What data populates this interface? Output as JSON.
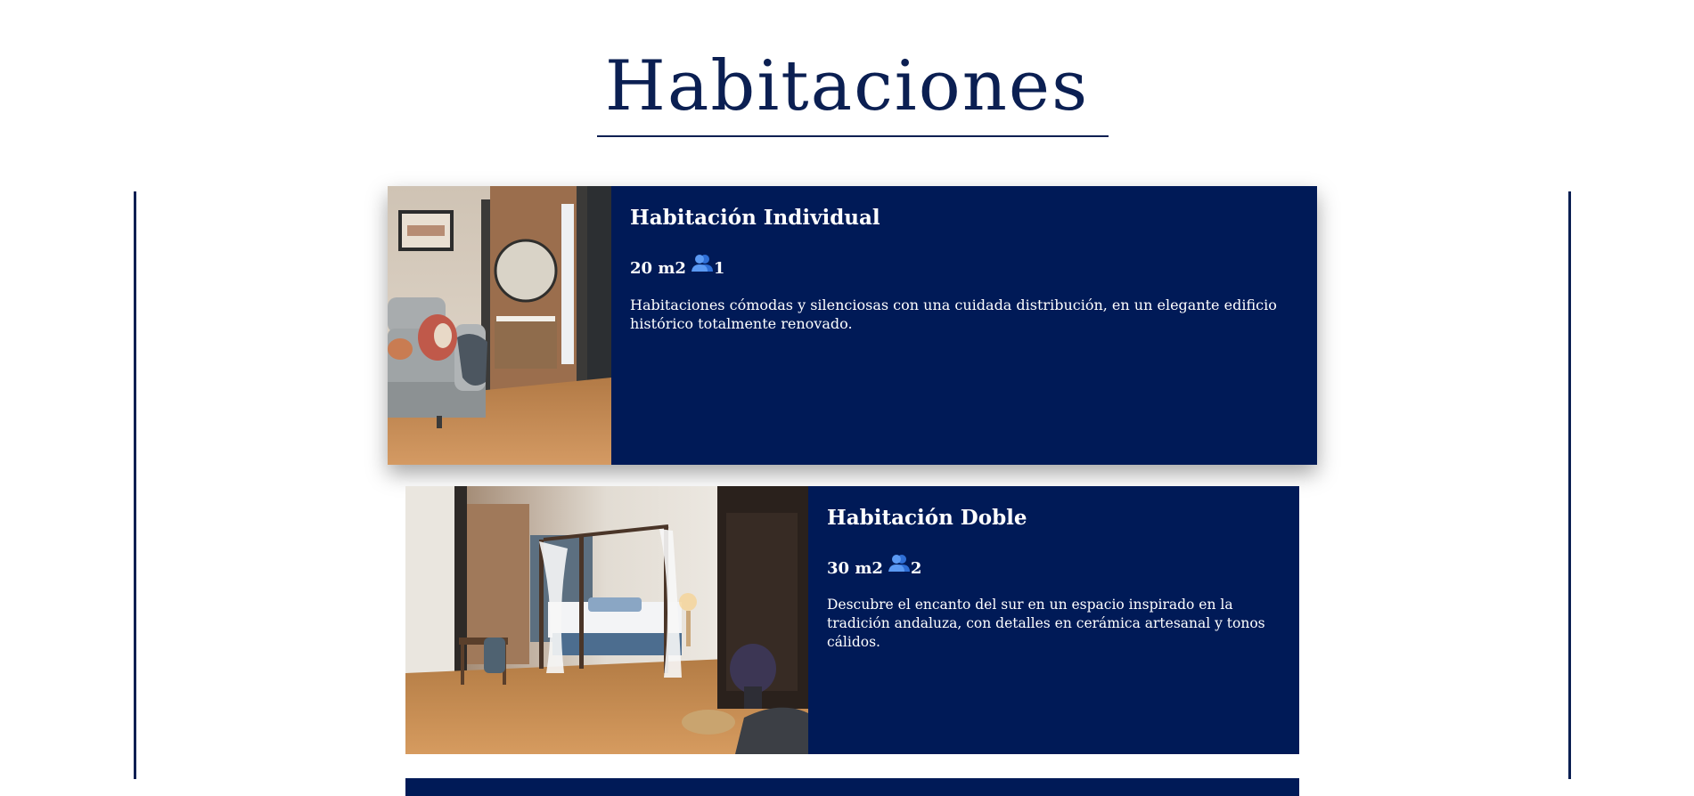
{
  "page": {
    "title": "Habitaciones"
  },
  "rooms": [
    {
      "name": "Habitación Individual",
      "size": "20 m2",
      "guests": "1",
      "description": "Habitaciones cómodas y silenciosas con una cuidada distribución, en un elegante edificio histórico totalmente renovado.",
      "image": "bedroom-with-armchair-and-bathroom-photo",
      "icon": "people-icon"
    },
    {
      "name": "Habitación Doble",
      "size": "30 m2",
      "guests": "2",
      "description": "Descubre el encanto del sur en un espacio inspirado en la tradición andaluza, con detalles en cerámica artesanal y tonos cálidos.",
      "image": "bedroom-with-canopy-bed-photo",
      "icon": "people-icon"
    }
  ],
  "colors": {
    "navy": "#001a57",
    "title": "#0b1f52",
    "icon_blue": "#3b82f6"
  }
}
